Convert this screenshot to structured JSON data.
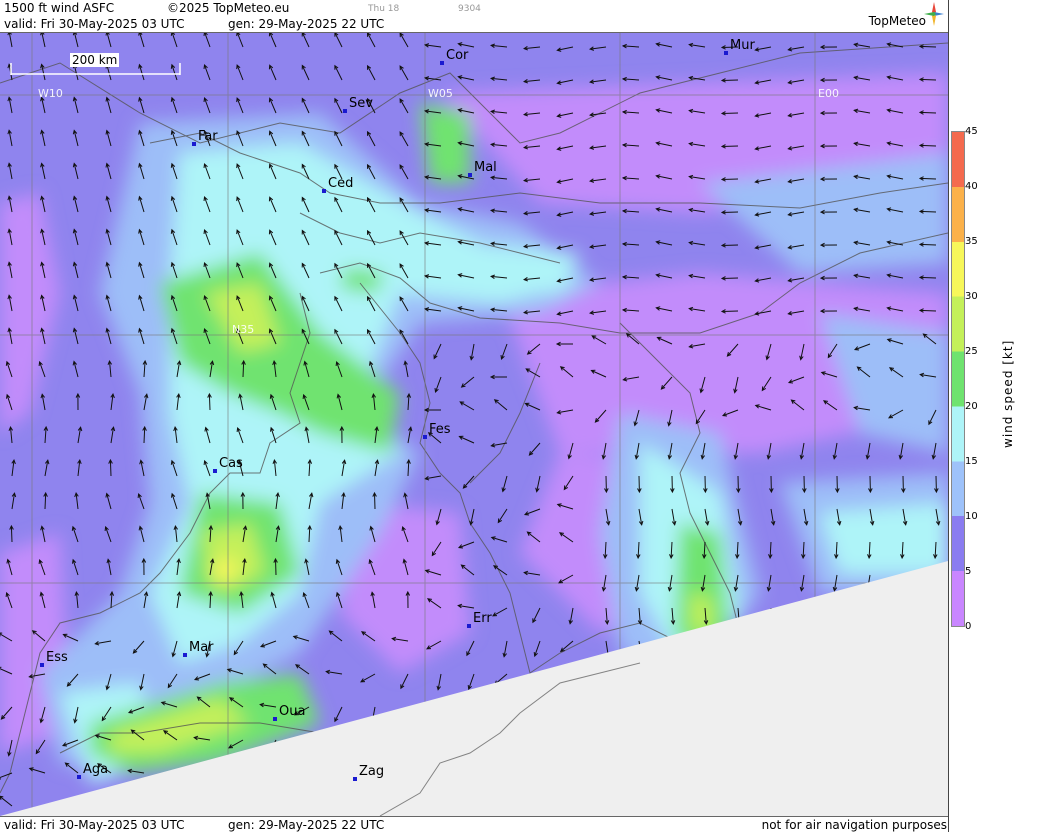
{
  "header": {
    "product": "1500 ft wind ASFC",
    "copyright": "©2025 TopMeteo.eu",
    "valid": "valid:  Fri  30-May-2025  03 UTC",
    "generated": "gen: 29-May-2025 22 UTC",
    "small1": "Thu 18",
    "small2": "9304",
    "logo": "TopMeteo"
  },
  "footer": {
    "valid": "valid:  Fri  30-May-2025  03 UTC",
    "generated": "gen: 29-May-2025 22 UTC",
    "disclaimer": "not for air navigation purposes"
  },
  "map": {
    "scale_label": "200 km",
    "grid_labels": [
      "W10",
      "W05",
      "E00",
      "N35"
    ],
    "cities": [
      "Cor",
      "Mur",
      "Sev",
      "Far",
      "Mal",
      "Ced",
      "Fes",
      "Cas",
      "Err",
      "Ess",
      "Mar",
      "Oua",
      "Aga",
      "Zag"
    ]
  },
  "legend": {
    "title": "wind  speed  [kt]",
    "ticks": [
      "45",
      "40",
      "35",
      "30",
      "25",
      "20",
      "15",
      "10",
      "5",
      "0"
    ],
    "colors": [
      "#c986ff",
      "#8a7cf0",
      "#9ec2fa",
      "#aef4f8",
      "#6fe36f",
      "#c4f05a",
      "#f7f75a",
      "#fbb14a",
      "#f46a4e"
    ]
  }
}
